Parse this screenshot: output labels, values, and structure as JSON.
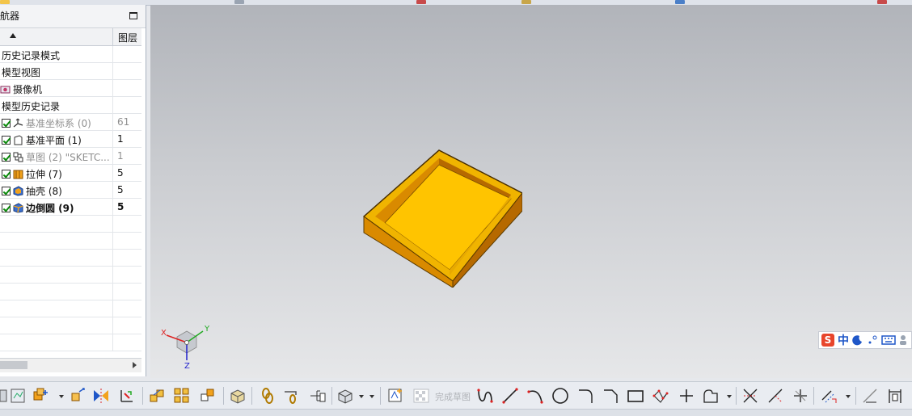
{
  "navigator": {
    "title": "导航器",
    "columns": {
      "layer": "图层"
    },
    "groups": [
      {
        "label": "历史记录模式"
      },
      {
        "label": "模型视图"
      },
      {
        "label": "摄像机"
      },
      {
        "label": "模型历史记录"
      }
    ],
    "features": [
      {
        "name": "基准坐标系 (0)",
        "layer": "61",
        "icon": "datum-csys-icon",
        "style": "gray"
      },
      {
        "name": "基准平面 (1)",
        "layer": "1",
        "icon": "datum-plane-icon",
        "style": "normal"
      },
      {
        "name": "草图 (2) \"SKETC...",
        "layer": "1",
        "icon": "sketch-icon",
        "style": "gray"
      },
      {
        "name": "拉伸 (7)",
        "layer": "5",
        "icon": "extrude-icon",
        "style": "normal"
      },
      {
        "name": "抽壳 (8)",
        "layer": "5",
        "icon": "shell-icon",
        "style": "normal"
      },
      {
        "name": "边倒圆 (9)",
        "layer": "5",
        "icon": "edge-blend-icon",
        "style": "bold"
      }
    ]
  },
  "viewport": {
    "triad": {
      "x": "X",
      "y": "Y",
      "z": "Z"
    },
    "model_colors": {
      "top": "#f0b400",
      "floor": "#ffc400",
      "wall_light": "#d98a00",
      "wall_dark": "#b66900"
    }
  },
  "ime": {
    "brand": "S",
    "mode": "中",
    "icons": [
      "moon-icon",
      "punctuation-icon",
      "keyboard-icon",
      "user-icon"
    ]
  },
  "toolbar": {
    "finish_sketch": "完成草图"
  }
}
